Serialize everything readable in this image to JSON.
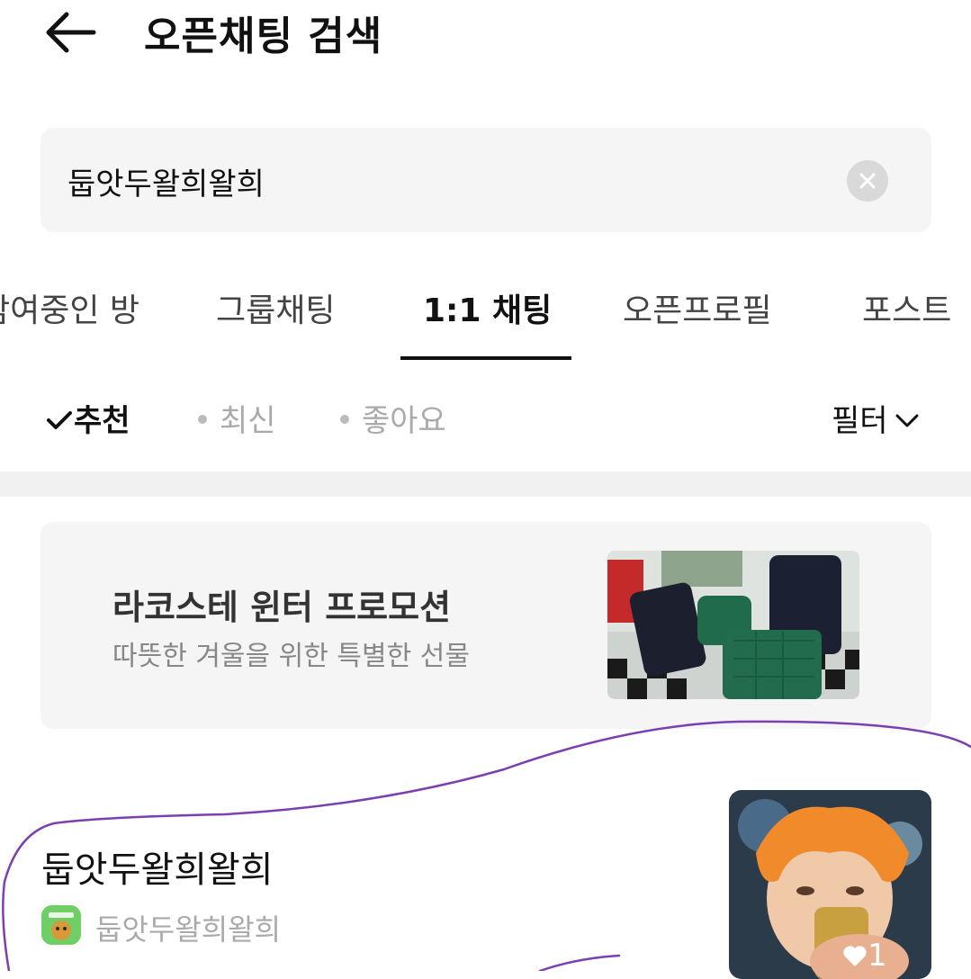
{
  "header": {
    "title": "오픈채팅 검색"
  },
  "search": {
    "value": "둡앗두왈희왈희"
  },
  "tabs": [
    {
      "label": "참여중인 방"
    },
    {
      "label": "그룹채팅"
    },
    {
      "label": "1:1 채팅"
    },
    {
      "label": "오픈프로필"
    },
    {
      "label": "포스트"
    }
  ],
  "active_tab": "1:1 채팅",
  "sort": {
    "options": [
      {
        "label": "추천",
        "selected": true
      },
      {
        "label": "최신",
        "selected": false
      },
      {
        "label": "좋아요",
        "selected": false
      }
    ],
    "filter_label": "필터"
  },
  "ad": {
    "title": "라코스테 윈터 프로모션",
    "subtitle": "따뜻한 겨울을 위한 특별한 선물"
  },
  "results": [
    {
      "name": "둡앗두왈희왈희",
      "host": "둡앗두왈희왈희",
      "likes": "1"
    }
  ],
  "colors": {
    "search_bg": "#f5f5f5",
    "divider": "#f1f1f1",
    "annotation_stroke": "#7b3fb0",
    "host_avatar": "#6fcf66"
  },
  "icons": [
    "back-arrow-icon",
    "clear-icon",
    "check-icon",
    "chevron-down-icon",
    "heart-icon"
  ]
}
